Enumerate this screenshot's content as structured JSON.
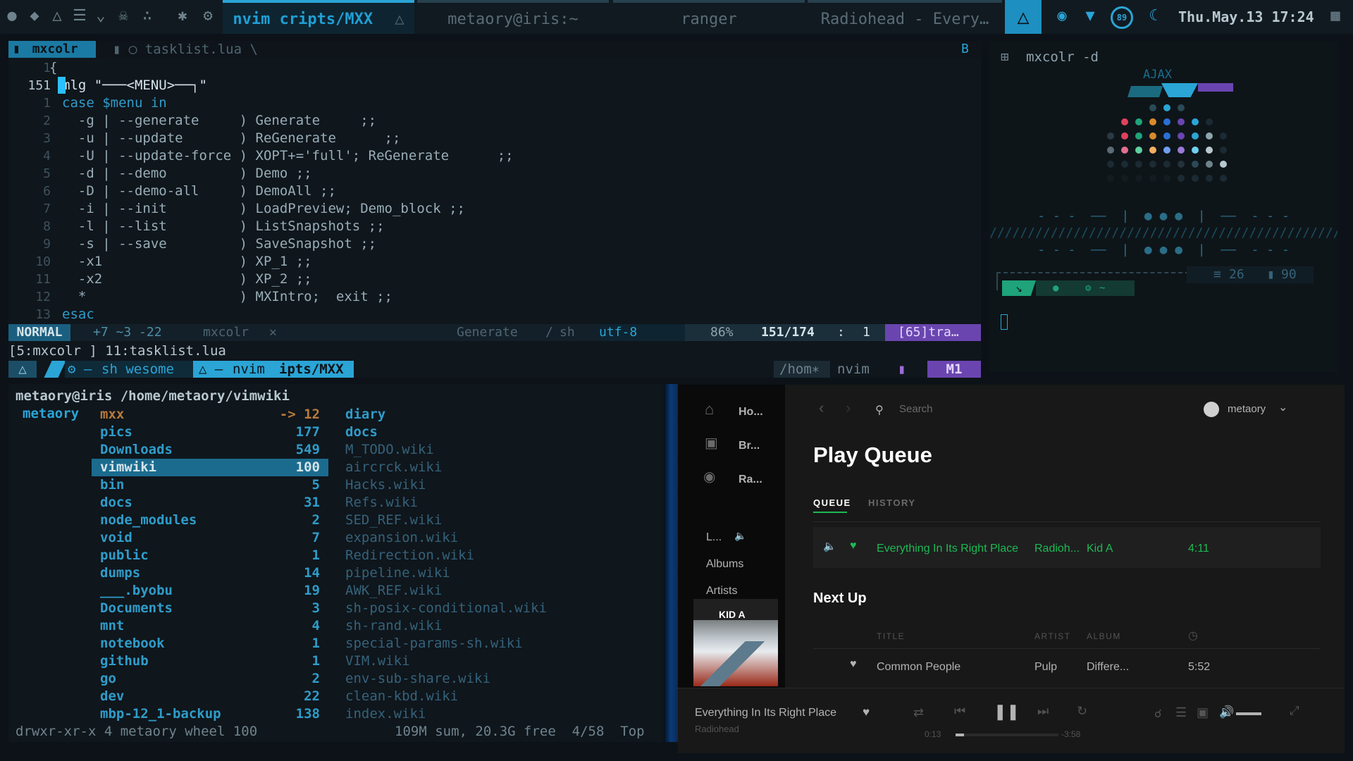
{
  "topbar": {
    "tabs": [
      {
        "label": "nvim cripts/MXX",
        "active": true
      },
      {
        "label": "metaory@iris:~",
        "active": false
      },
      {
        "label": "ranger",
        "active": false
      },
      {
        "label": "Radiohead - Every…",
        "active": false
      }
    ],
    "battery": "89",
    "datetime": "Thu.May.13  17:24",
    "accent": "#2aa5d6"
  },
  "vim": {
    "tab_name": "mxcolr",
    "file_tab": "tasklist.lua",
    "tab_marker": "B",
    "lines": [
      {
        "num": "1",
        "text": "{"
      },
      {
        "num": "151",
        "text": "mlg \"───<MENU>──┐\""
      },
      {
        "num": "1",
        "text": "case $menu in"
      },
      {
        "num": "2",
        "text": "  -g | --generate     ) Generate     ;;"
      },
      {
        "num": "3",
        "text": "  -u | --update       ) ReGenerate      ;;"
      },
      {
        "num": "4",
        "text": "  -U | --update-force ) XOPT+='full'; ReGenerate      ;;"
      },
      {
        "num": "5",
        "text": "  -d | --demo         ) Demo ;;"
      },
      {
        "num": "6",
        "text": "  -D | --demo-all     ) DemoAll ;;"
      },
      {
        "num": "7",
        "text": "  -i | --init         ) LoadPreview; Demo_block ;;"
      },
      {
        "num": "8",
        "text": "  -l | --list         ) ListSnapshots ;;"
      },
      {
        "num": "9",
        "text": "  -s | --save         ) SaveSnapshot ;;"
      },
      {
        "num": "10",
        "text": "  -x1                 ) XP_1 ;;"
      },
      {
        "num": "11",
        "text": "  -x2                 ) XP_2 ;;"
      },
      {
        "num": "12",
        "text": "  *                   ) MXIntro;  exit ;;"
      },
      {
        "num": "13",
        "text": "esac"
      }
    ],
    "status": {
      "mode": "NORMAL",
      "diff": "+7 ~3 -22",
      "branch": "mxcolr",
      "func": "Generate",
      "ft": "sh",
      "enc": "utf-8",
      "percent": "86%",
      "pos": "151/174",
      "col": "1",
      "extra": "[65]tra…"
    },
    "cmdline": "[5:mxcolr ] 11:tasklist.lua",
    "tmux": {
      "left_a": "sh wesome",
      "path": "nvim",
      "path2": "ipts/MXX",
      "right1": "/hom∗",
      "right2": "nvim",
      "right3": "M1"
    }
  },
  "side": {
    "prompt": "mxcolr -d",
    "logo_text": "AJAX",
    "stat1": "26",
    "stat2": "90",
    "hint": "~"
  },
  "ranger": {
    "path": "metaory@iris /home/metaory/vimwiki",
    "parent": "metaory",
    "dirs": [
      {
        "name": "mxx",
        "count": "-> 12"
      },
      {
        "name": "pics",
        "count": "177"
      },
      {
        "name": "Downloads",
        "count": "549"
      },
      {
        "name": "vimwiki",
        "count": "100",
        "selected": true
      },
      {
        "name": "bin",
        "count": "5"
      },
      {
        "name": "docs",
        "count": "31"
      },
      {
        "name": "node_modules",
        "count": "2"
      },
      {
        "name": "void",
        "count": "7"
      },
      {
        "name": "public",
        "count": "1"
      },
      {
        "name": "dumps",
        "count": "14"
      },
      {
        "name": "___.byobu",
        "count": "19"
      },
      {
        "name": "Documents",
        "count": "3"
      },
      {
        "name": "mnt",
        "count": "4"
      },
      {
        "name": "notebook",
        "count": "1"
      },
      {
        "name": "github",
        "count": "1"
      },
      {
        "name": "go",
        "count": "2"
      },
      {
        "name": "dev",
        "count": "22"
      },
      {
        "name": "mbp-12_1-backup",
        "count": "138"
      }
    ],
    "preview": [
      "diary",
      "docs",
      "M_TODO.wiki",
      "aircrck.wiki",
      "Hacks.wiki",
      "Refs.wiki",
      "SED_REF.wiki",
      "expansion.wiki",
      "Redirection.wiki",
      "pipeline.wiki",
      "AWK_REF.wiki",
      "sh-posix-conditional.wiki",
      "sh-rand.wiki",
      "special-params-sh.wiki",
      "VIM.wiki",
      "env-sub-share.wiki",
      "clean-kbd.wiki",
      "index.wiki"
    ],
    "footer_left": "drwxr-xr-x 4 metaory wheel 100",
    "footer_right": "109M sum, 20.3G free  4/58  Top"
  },
  "spotify": {
    "nav": [
      "Ho...",
      "Br...",
      "Ra..."
    ],
    "library": [
      "L...",
      "Albums",
      "Artists"
    ],
    "search_placeholder": "Search",
    "user": "metaory",
    "page_title": "Play Queue",
    "tabs": [
      "QUEUE",
      "HISTORY"
    ],
    "headers": {
      "title": "TITLE",
      "artist": "ARTIST",
      "album": "ALBUM"
    },
    "now_playing": {
      "title": "Everything In Its Right Place",
      "artist": "Radioh...",
      "album": "Kid A",
      "duration": "4:11"
    },
    "next_up_label": "Next Up",
    "next": {
      "title": "Common People",
      "artist": "Pulp",
      "album": "Differe...",
      "duration": "5:52"
    },
    "cover_text": "KID A",
    "player": {
      "title": "Everything In Its Right Place",
      "artist": "Radiohead",
      "elapsed": "0:13",
      "remaining": "-3:58"
    },
    "green": "#1db954"
  }
}
